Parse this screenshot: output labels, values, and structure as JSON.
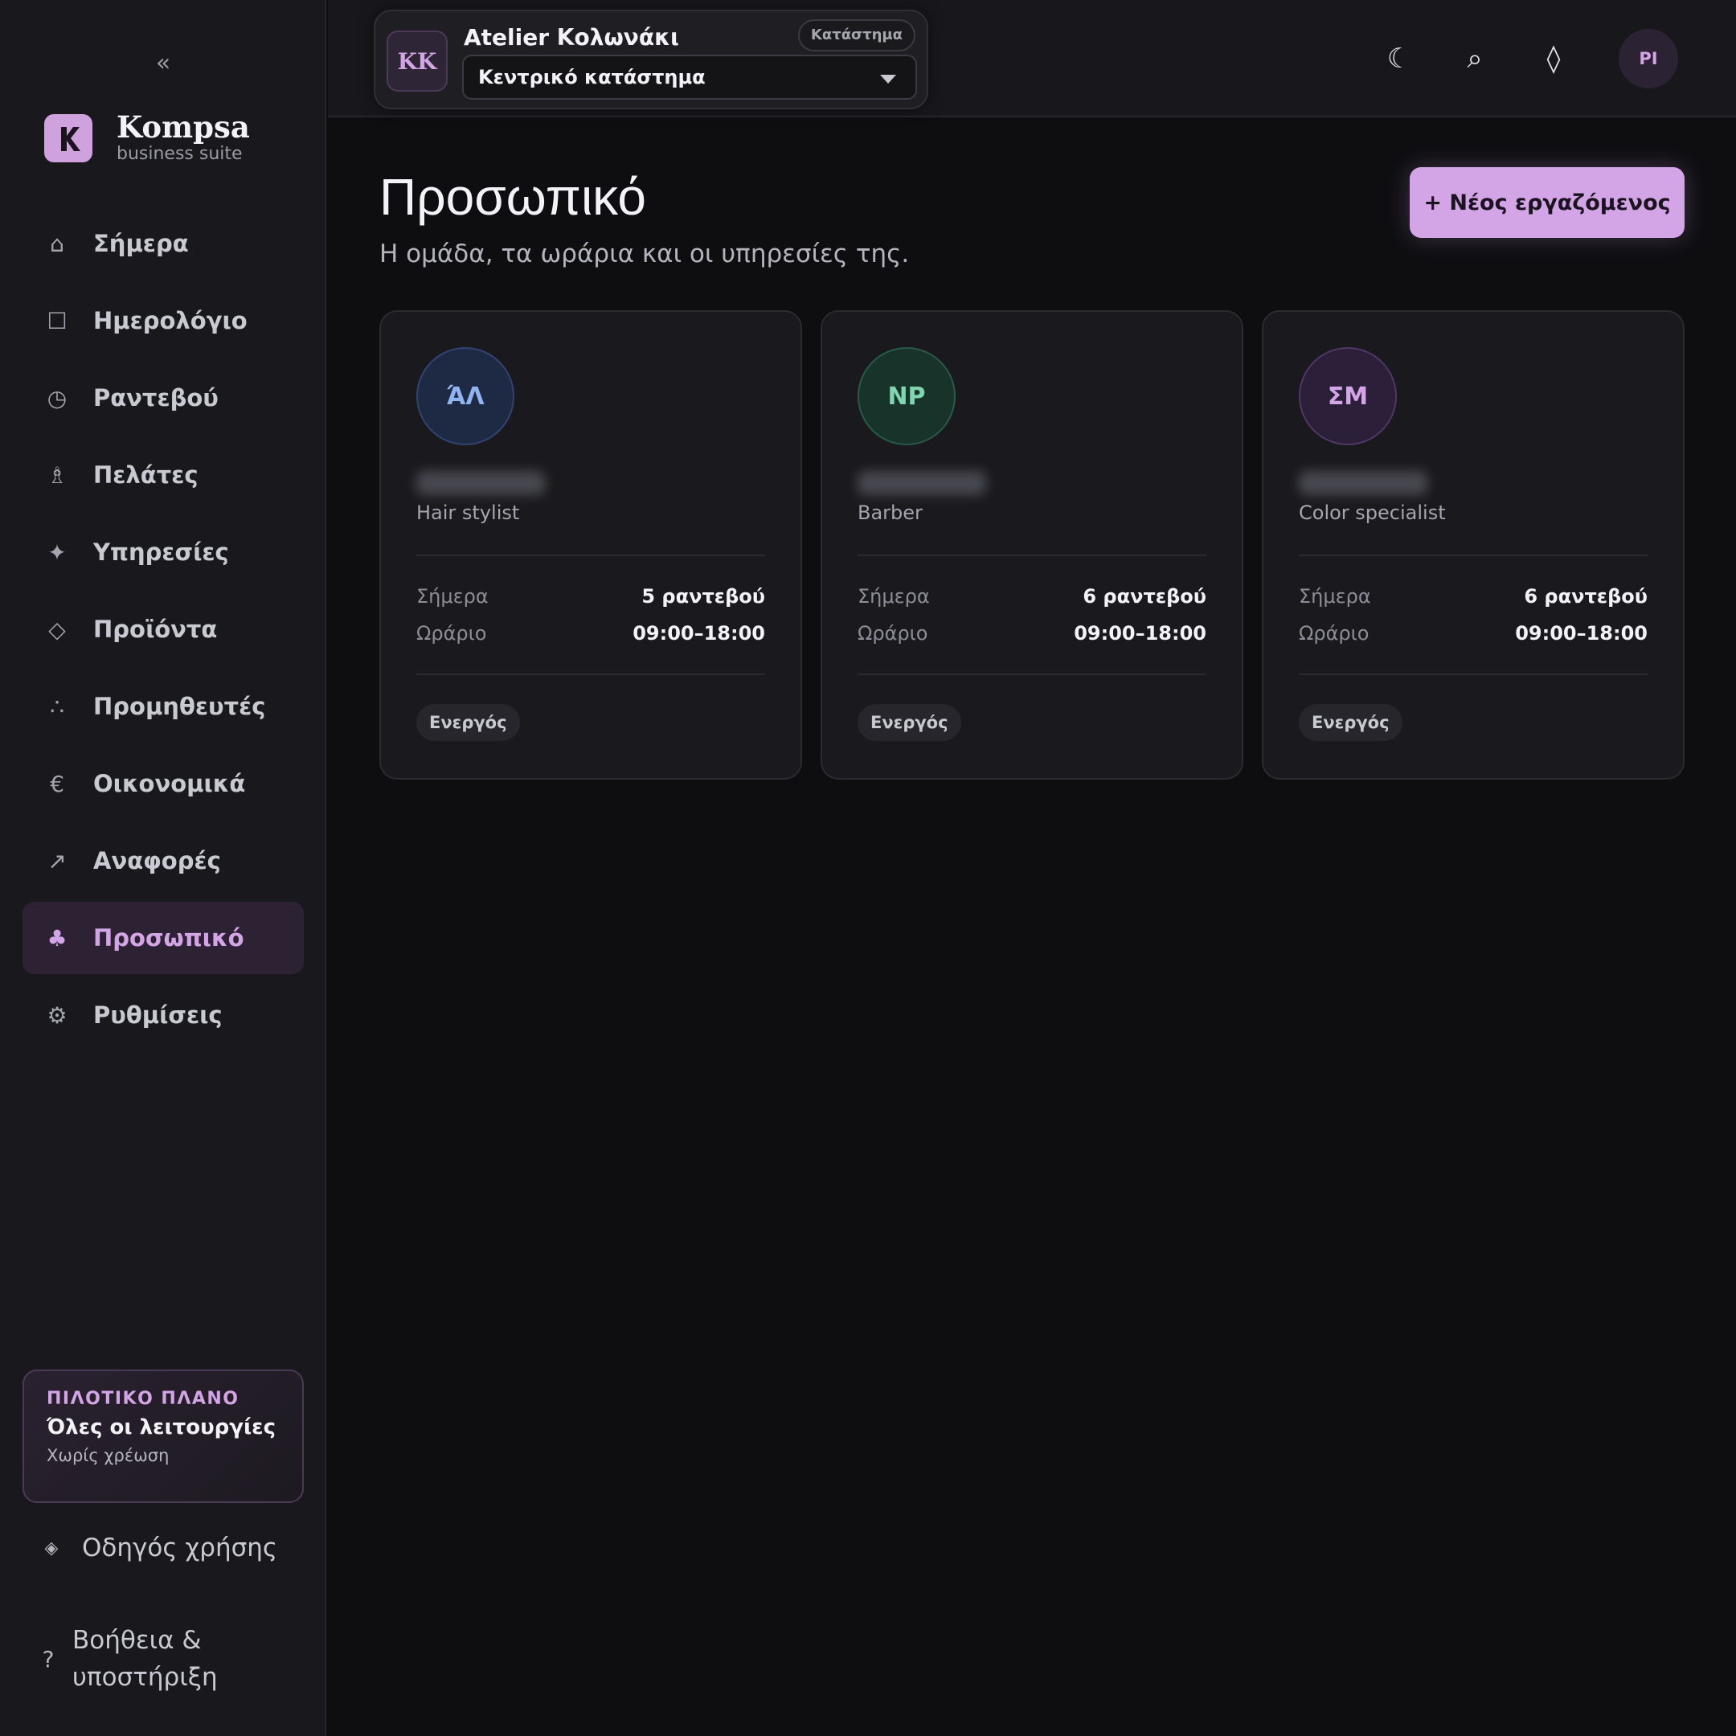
{
  "sidebar": {
    "collapse_label": "«",
    "brand": {
      "name": "Kompsa",
      "subtitle": "business suite"
    },
    "nav": [
      {
        "icon": "home-icon",
        "glyph": "⌂",
        "label": "Σήμερα",
        "active": false
      },
      {
        "icon": "calendar-icon",
        "glyph": "☐",
        "label": "Ημερολόγιο",
        "active": false
      },
      {
        "icon": "clock-icon",
        "glyph": "◷",
        "label": "Ραντεβού",
        "active": false
      },
      {
        "icon": "clients-icon",
        "glyph": "♗",
        "label": "Πελάτες",
        "active": false
      },
      {
        "icon": "sparkle-icon",
        "glyph": "✦",
        "label": "Υπηρεσίες",
        "active": false
      },
      {
        "icon": "diamond-icon",
        "glyph": "◇",
        "label": "Προϊόντα",
        "active": false
      },
      {
        "icon": "suppliers-icon",
        "glyph": "∴",
        "label": "Προμηθευτές",
        "active": false
      },
      {
        "icon": "euro-icon",
        "glyph": "€",
        "label": "Οικονομικά",
        "active": false
      },
      {
        "icon": "arrow-up-right-icon",
        "glyph": "↗",
        "label": "Αναφορές",
        "active": false
      },
      {
        "icon": "staff-icon",
        "glyph": "♣",
        "label": "Προσωπικό",
        "active": true
      },
      {
        "icon": "settings-icon",
        "glyph": "⚙",
        "label": "Ρυθμίσεις",
        "active": false
      }
    ],
    "plan": {
      "kicker": "ΠΙΛΟΤΙΚΟ ΠΛΑΝΟ",
      "title": "Όλες οι λειτουργίες",
      "subtitle": "Χωρίς χρέωση"
    },
    "guide": {
      "glyph": "◈",
      "label": "Οδηγός χρήσης"
    },
    "help": {
      "glyph": "?",
      "label": "Βοήθεια & υποστήριξη"
    }
  },
  "topbar": {
    "store": {
      "initials": "KK",
      "name": "Atelier Κολωνάκι",
      "type_badge": "Κατάστημα",
      "selected_location": "Κεντρικό κατάστημα"
    },
    "icons": {
      "theme": "☾",
      "search": "⌕",
      "diamond": "◊"
    },
    "user_initials": "PI"
  },
  "main": {
    "title": "Προσωπικό",
    "subtitle": "Η ομάδα, τα ωράρια και οι υπηρεσίες της.",
    "new_button": "+ Νέος εργαζόμενος",
    "labels": {
      "today": "Σήμερα",
      "schedule": "Ωράριο"
    },
    "staff": [
      {
        "initials": "ΆΛ",
        "role": "Hair stylist",
        "today": "5 ραντεβού",
        "schedule": "09:00–18:00",
        "status": "Ενεργός",
        "color": "#8fb4f0",
        "bg": "#1e2a44",
        "border": "#2f4470"
      },
      {
        "initials": "NP",
        "role": "Barber",
        "today": "6 ραντεβού",
        "schedule": "09:00–18:00",
        "status": "Ενεργός",
        "color": "#7fd6b0",
        "bg": "#17332a",
        "border": "#285a47"
      },
      {
        "initials": "ΣΜ",
        "role": "Color specialist",
        "today": "6 ραντεβού",
        "schedule": "09:00–18:00",
        "status": "Ενεργός",
        "color": "#d4a5e6",
        "bg": "#2c1f3a",
        "border": "#4f3766"
      }
    ]
  },
  "colors": {
    "accent": "#d4a5e6",
    "background": "#0e0e11",
    "sidebar": "#19191d"
  }
}
